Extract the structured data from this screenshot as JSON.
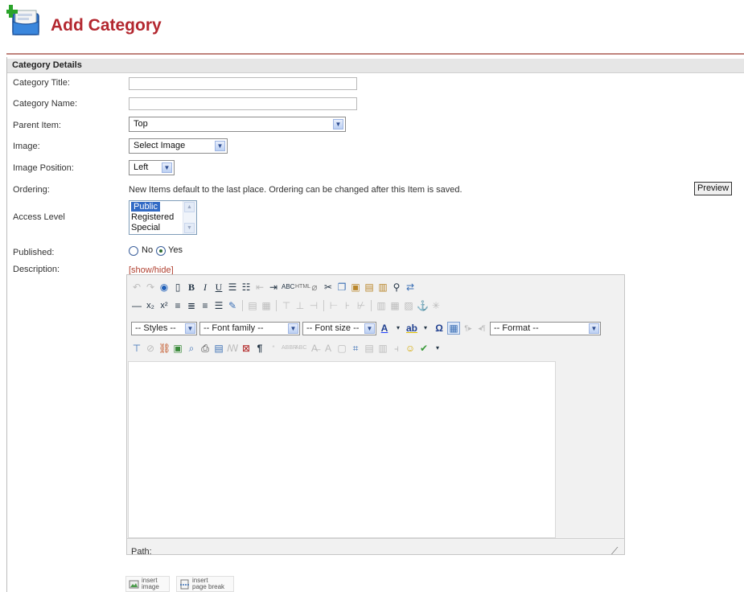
{
  "header": {
    "title": "Add Category",
    "icon": "category-add-icon"
  },
  "panel": {
    "heading": "Category Details"
  },
  "form": {
    "title_label": "Category Title:",
    "title_value": "",
    "name_label": "Category Name:",
    "name_value": "",
    "parent_label": "Parent Item:",
    "parent_value": "Top",
    "image_label": "Image:",
    "image_value": "Select Image",
    "position_label": "Image Position:",
    "position_value": "Left",
    "ordering_label": "Ordering:",
    "ordering_text": "New Items default to the last place. Ordering can be changed after this Item is saved.",
    "preview_label": "Preview",
    "access_label": "Access Level",
    "access_options": [
      "Public",
      "Registered",
      "Special"
    ],
    "access_selected": "Public",
    "published_label": "Published:",
    "published_no": "No",
    "published_yes": "Yes",
    "published_value": "Yes",
    "description_label": "Description:",
    "showhide_label": "[show/hide]"
  },
  "editor": {
    "styles_select": "-- Styles --",
    "font_family_select": "-- Font family --",
    "font_size_select": "-- Font size --",
    "format_select": "-- Format --",
    "path_label": "Path:"
  },
  "insert_buttons": {
    "image_label_1": "insert",
    "image_label_2": "image",
    "pagebreak_label_1": "insert",
    "pagebreak_label_2": "page break"
  },
  "colors": {
    "title": "#b3272f",
    "header_rule": "#c0847d",
    "panel_head_bg": "#e6e6e6",
    "showhide": "#b04030",
    "selection": "#316ac5"
  }
}
